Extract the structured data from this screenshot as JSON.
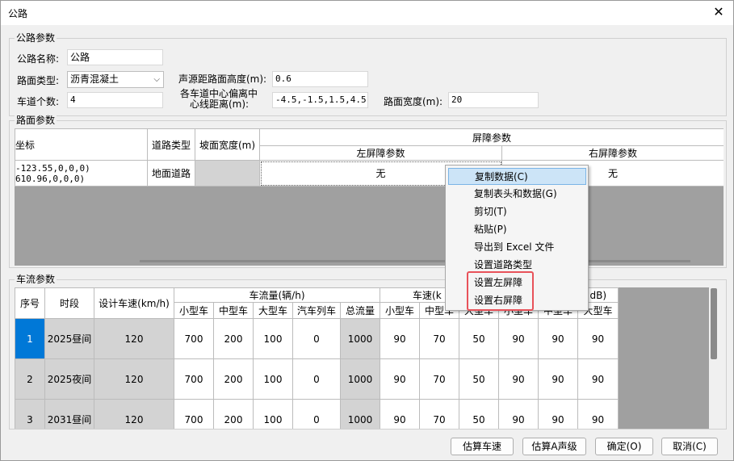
{
  "window": {
    "title": "公路",
    "close_glyph": "✕"
  },
  "road_params": {
    "group_title": "公路参数",
    "name_label": "公路名称:",
    "name_value": "公路",
    "surface_label": "路面类型:",
    "surface_value": "沥青混凝土",
    "lanes_label": "车道个数:",
    "lanes_value": "4",
    "source_height_label": "声源距路面高度(m):",
    "source_height_value": "0.6",
    "lane_offset_label_1": "各车道中心偏离中",
    "lane_offset_label_2": "心线距离(m):",
    "lane_offset_value": "-4.5,-1.5,1.5,4.5",
    "road_width_label": "路面宽度(m):",
    "road_width_value": "20"
  },
  "surface_params": {
    "group_title": "路面参数",
    "headers": {
      "coord": "坐标",
      "road_type": "道路类型",
      "slope_width": "坡面宽度(m)",
      "barrier": "屏障参数",
      "left_barrier": "左屏障参数",
      "right_barrier": "右屏障参数"
    },
    "row": {
      "coord_1": "-123.55,0,0,0)",
      "coord_2": "610.96,0,0,0)",
      "road_type": "地面道路",
      "left": "无",
      "right": "无"
    }
  },
  "context_menu": {
    "items": [
      "复制数据(C)",
      "复制表头和数据(G)",
      "剪切(T)",
      "粘贴(P)",
      "导出到 Excel 文件",
      "设置道路类型",
      "设置左屏障",
      "设置右屏障"
    ]
  },
  "traffic_params": {
    "group_title": "车流参数",
    "headers": {
      "seq": "序号",
      "period": "时段",
      "design_speed": "设计车速(km/h)",
      "flow_group": "车流量(辆/h)",
      "speed_group": "车速(k",
      "right_unit": "dB)"
    },
    "flow_cols": [
      "小型车",
      "中型车",
      "大型车",
      "汽车列车",
      "总流量"
    ],
    "speed_cols": [
      "小型车",
      "中型车",
      "大型车",
      "小型车",
      "中型车",
      "大型车"
    ],
    "rows": [
      {
        "seq": "1",
        "period": "2025昼间",
        "speed": "120",
        "flows": [
          "700",
          "200",
          "100",
          "0",
          "1000"
        ],
        "speeds": [
          "90",
          "70",
          "50",
          "90",
          "90",
          "90"
        ]
      },
      {
        "seq": "2",
        "period": "2025夜间",
        "speed": "120",
        "flows": [
          "700",
          "200",
          "100",
          "0",
          "1000"
        ],
        "speeds": [
          "90",
          "70",
          "50",
          "90",
          "90",
          "90"
        ]
      },
      {
        "seq": "3",
        "period": "2031昼间",
        "speed": "120",
        "flows": [
          "700",
          "200",
          "100",
          "0",
          "1000"
        ],
        "speeds": [
          "90",
          "70",
          "50",
          "90",
          "90",
          "90"
        ]
      }
    ]
  },
  "buttons": {
    "estimate_speed": "估算车速",
    "estimate_level": "估算A声级",
    "ok": "确定(O)",
    "cancel": "取消(C)"
  },
  "colors": {
    "selected_cell": "#0078d7",
    "menu_hover": "#cce4f7",
    "highlight": "#e8525a"
  }
}
